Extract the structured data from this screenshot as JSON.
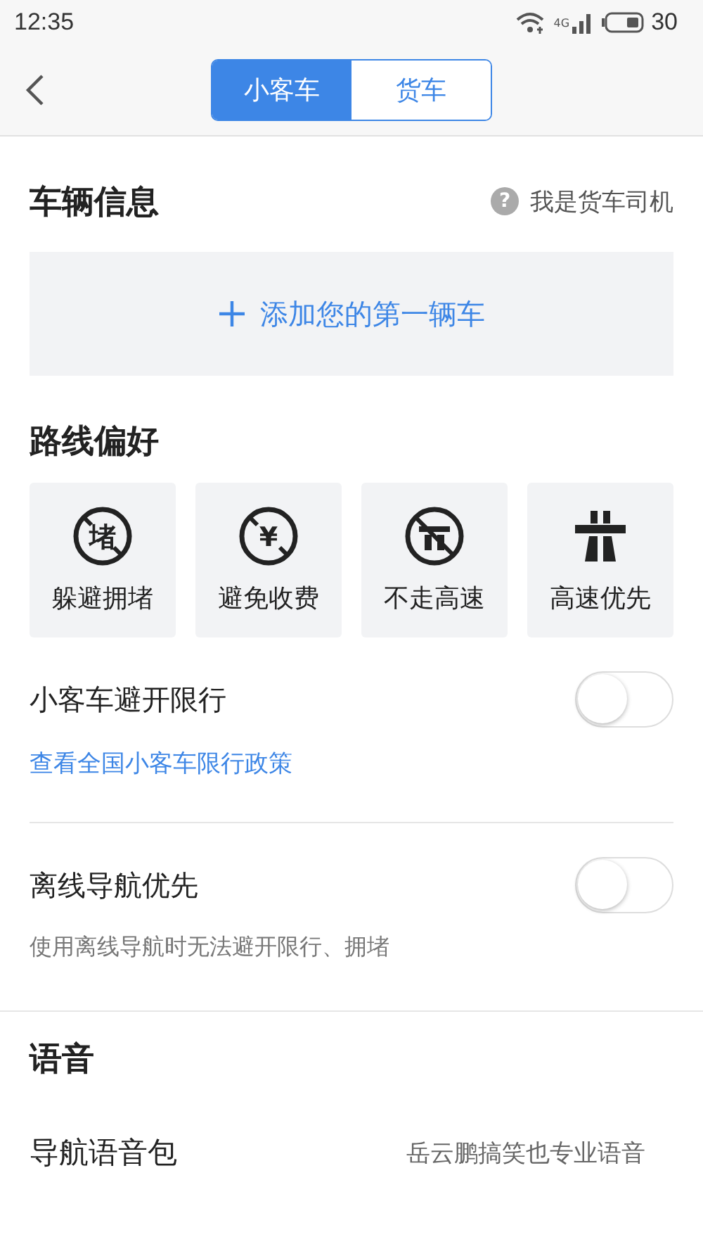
{
  "status_bar": {
    "time": "12:35",
    "network": "4G",
    "battery": "30"
  },
  "nav": {
    "tabs": [
      {
        "label": "小客车",
        "selected": true
      },
      {
        "label": "货车",
        "selected": false
      }
    ]
  },
  "vehicle": {
    "title": "车辆信息",
    "help_icon": "?",
    "help_link": "我是货车司机",
    "add_button": "添加您的第一辆车"
  },
  "route": {
    "title": "路线偏好",
    "options": [
      {
        "label": "躲避拥堵",
        "kind": "glyph",
        "icon_text": "堵"
      },
      {
        "label": "避免收费",
        "kind": "glyph",
        "icon_text": "¥"
      },
      {
        "label": "不走高速",
        "kind": "no-road"
      },
      {
        "label": "高速优先",
        "kind": "road"
      }
    ]
  },
  "settings": [
    {
      "label": "小客车避开限行",
      "on": false,
      "kind": "link",
      "extra": "查看全国小客车限行政策"
    },
    {
      "label": "离线导航优先",
      "on": false,
      "kind": "note",
      "extra": "使用离线导航时无法避开限行、拥堵"
    }
  ],
  "voice": {
    "title": "语音",
    "rows": [
      {
        "label": "导航语音包",
        "value": "岳云鹏搞笑也专业语音"
      }
    ]
  }
}
